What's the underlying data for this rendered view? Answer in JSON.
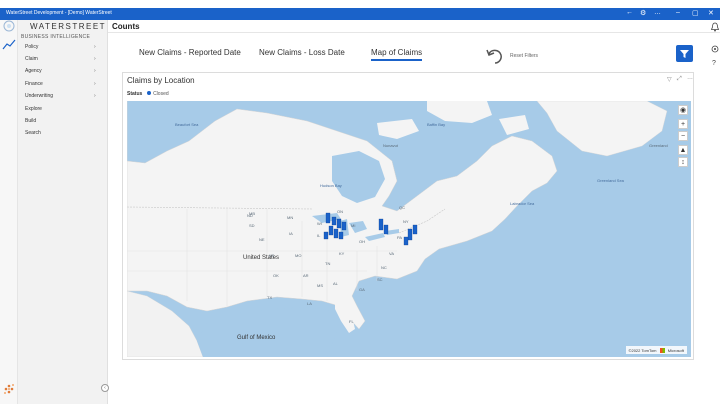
{
  "window": {
    "title": "WaterStreet Development - [Demo] WaterStreet"
  },
  "sidebar": {
    "logo": "WATERSTREET",
    "subtitle": "BUSINESS INTELLIGENCE",
    "items": [
      {
        "label": "Policy",
        "expandable": true
      },
      {
        "label": "Claim",
        "expandable": true
      },
      {
        "label": "Agency",
        "expandable": true
      },
      {
        "label": "Finance",
        "expandable": true
      },
      {
        "label": "Underwriting",
        "expandable": true
      },
      {
        "label": "Explore",
        "expandable": false
      },
      {
        "label": "Build",
        "expandable": false
      },
      {
        "label": "Search",
        "expandable": false
      }
    ]
  },
  "header": {
    "title": "Counts"
  },
  "tabs": [
    {
      "label": "New Claims - Reported Date",
      "active": false
    },
    {
      "label": "New Claims - Loss Date",
      "active": false
    },
    {
      "label": "Map of Claims",
      "active": true
    }
  ],
  "reset_filters": {
    "label": "Reset Filters"
  },
  "visual": {
    "title": "Claims by Location",
    "legend_title": "Status",
    "legend_item": "Closed",
    "legend_color": "#1a62c9"
  },
  "map": {
    "labels": {
      "gulf_of_mexico": "Gulf of Mexico",
      "united_states": "United States",
      "hudson_bay": "Hudson Bay",
      "labrador_sea": "Labrador Sea",
      "greenland_sea": "Greenland Sea",
      "baffin_bay": "Baffin Bay",
      "beaufort_sea": "Beaufort Sea",
      "greenland": "Greenland",
      "nunavut": "Nunavut",
      "ontario": "ON",
      "quebec": "QC",
      "manitoba": "MB",
      "texas": "TX",
      "michigan": "MI",
      "ohio": "OH",
      "pennsylvania": "PA",
      "new_york": "NY",
      "tennessee": "TN",
      "north_carolina": "NC",
      "georgia": "GA",
      "florida": "FL",
      "kentucky": "KY",
      "virginia": "VA",
      "illinois": "IL",
      "iowa": "IA",
      "missouri": "MO",
      "alabama": "AL",
      "mississippi": "MS",
      "louisiana": "LA",
      "arkansas": "AR",
      "oklahoma": "OK",
      "kansas": "KS",
      "nebraska": "NE",
      "south_dakota": "SD",
      "north_dakota": "ND",
      "minnesota": "MN",
      "wisconsin": "WI",
      "south_carolina": "SC"
    },
    "attribution_year": "©2022 TomTom",
    "attribution_brand": "Microsoft",
    "zoom_in": "+",
    "zoom_out": "−"
  }
}
